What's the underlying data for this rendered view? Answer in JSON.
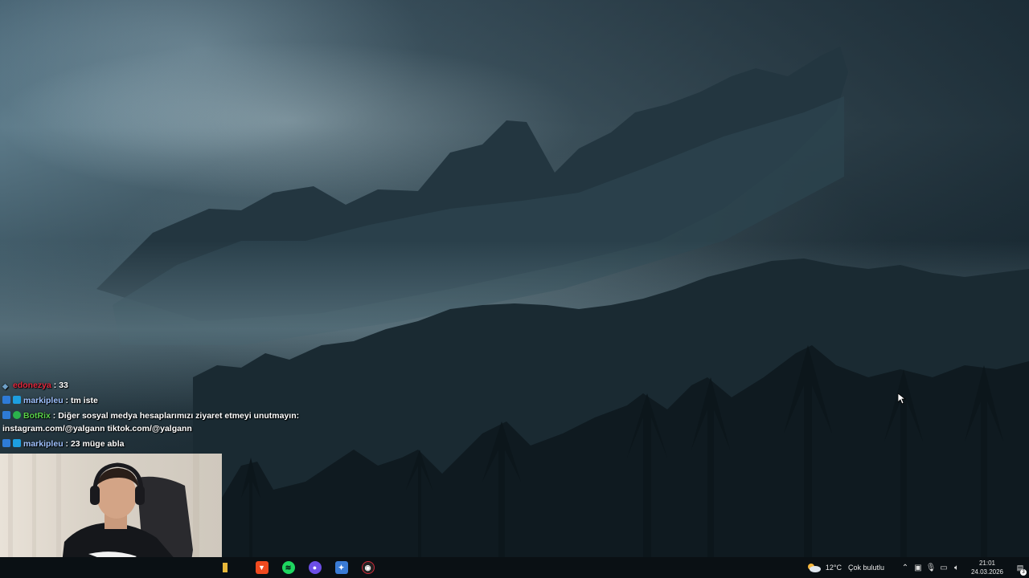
{
  "chat": {
    "messages": [
      {
        "user": "edonezya",
        "sep": " : ",
        "text": "33"
      },
      {
        "user": "markipleu",
        "sep": " : ",
        "text": "tm iste"
      },
      {
        "user": "BotRix",
        "sep": " : ",
        "text": "Diğer sosyal medya hesaplarımızı ziyaret etmeyi unutmayın:",
        "text2": "instagram.com/@yalgann tiktok.com/@yalgann"
      },
      {
        "user": "markipleu",
        "sep": " : ",
        "text": "23 müge abla"
      }
    ]
  },
  "taskbar": {
    "apps": [
      {
        "icon": "folder-icon",
        "color": "#e8b83a"
      },
      {
        "icon": "brave-icon",
        "color": "#f04a1f"
      },
      {
        "icon": "spotify-icon",
        "color": "#1ed760"
      },
      {
        "icon": "discord-icon",
        "color": "#6c4ee6"
      },
      {
        "icon": "app-icon",
        "color": "#3a7bd5"
      },
      {
        "icon": "obs-icon",
        "color": "#d02a3a"
      }
    ],
    "weather": {
      "temp": "12°C",
      "condition": "Çok bulutlu"
    },
    "clock": {
      "time": "21:01",
      "date": "24.03.2026"
    },
    "notification_count": "3"
  }
}
